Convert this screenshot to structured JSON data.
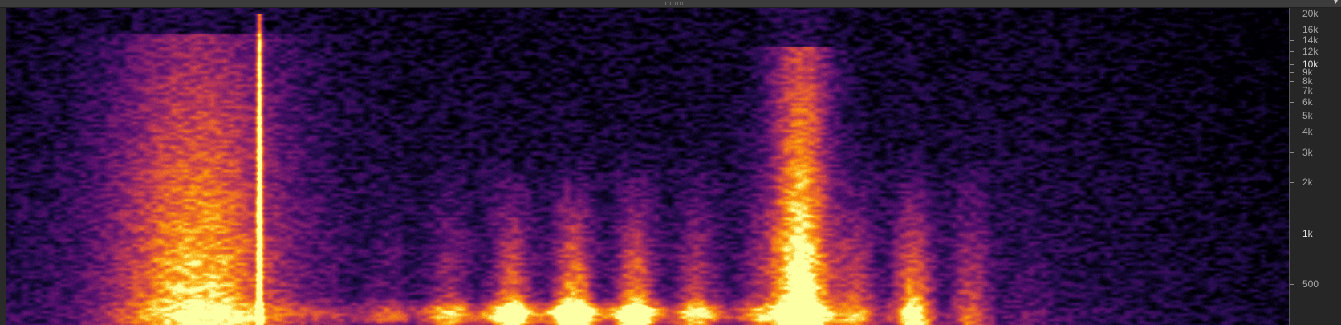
{
  "panel": {
    "collapse_icon": "chevron-down-icon",
    "grip_icon": "drag-handle-icon"
  },
  "colormap": "inferno",
  "frequency_axis": {
    "scale": "log",
    "ticks": [
      {
        "label": "20k",
        "hz": 20000
      },
      {
        "label": "16k",
        "hz": 16000
      },
      {
        "label": "14k",
        "hz": 14000
      },
      {
        "label": "12k",
        "hz": 12000
      },
      {
        "label": "10k",
        "hz": 10000
      },
      {
        "label": "9k",
        "hz": 9000
      },
      {
        "label": "8k",
        "hz": 8000
      },
      {
        "label": "7k",
        "hz": 7000
      },
      {
        "label": "6k",
        "hz": 6000
      },
      {
        "label": "5k",
        "hz": 5000
      },
      {
        "label": "4k",
        "hz": 4000
      },
      {
        "label": "3k",
        "hz": 3000
      },
      {
        "label": "2k",
        "hz": 2000
      },
      {
        "label": "1k",
        "hz": 1000
      },
      {
        "label": "500",
        "hz": 500
      }
    ]
  }
}
